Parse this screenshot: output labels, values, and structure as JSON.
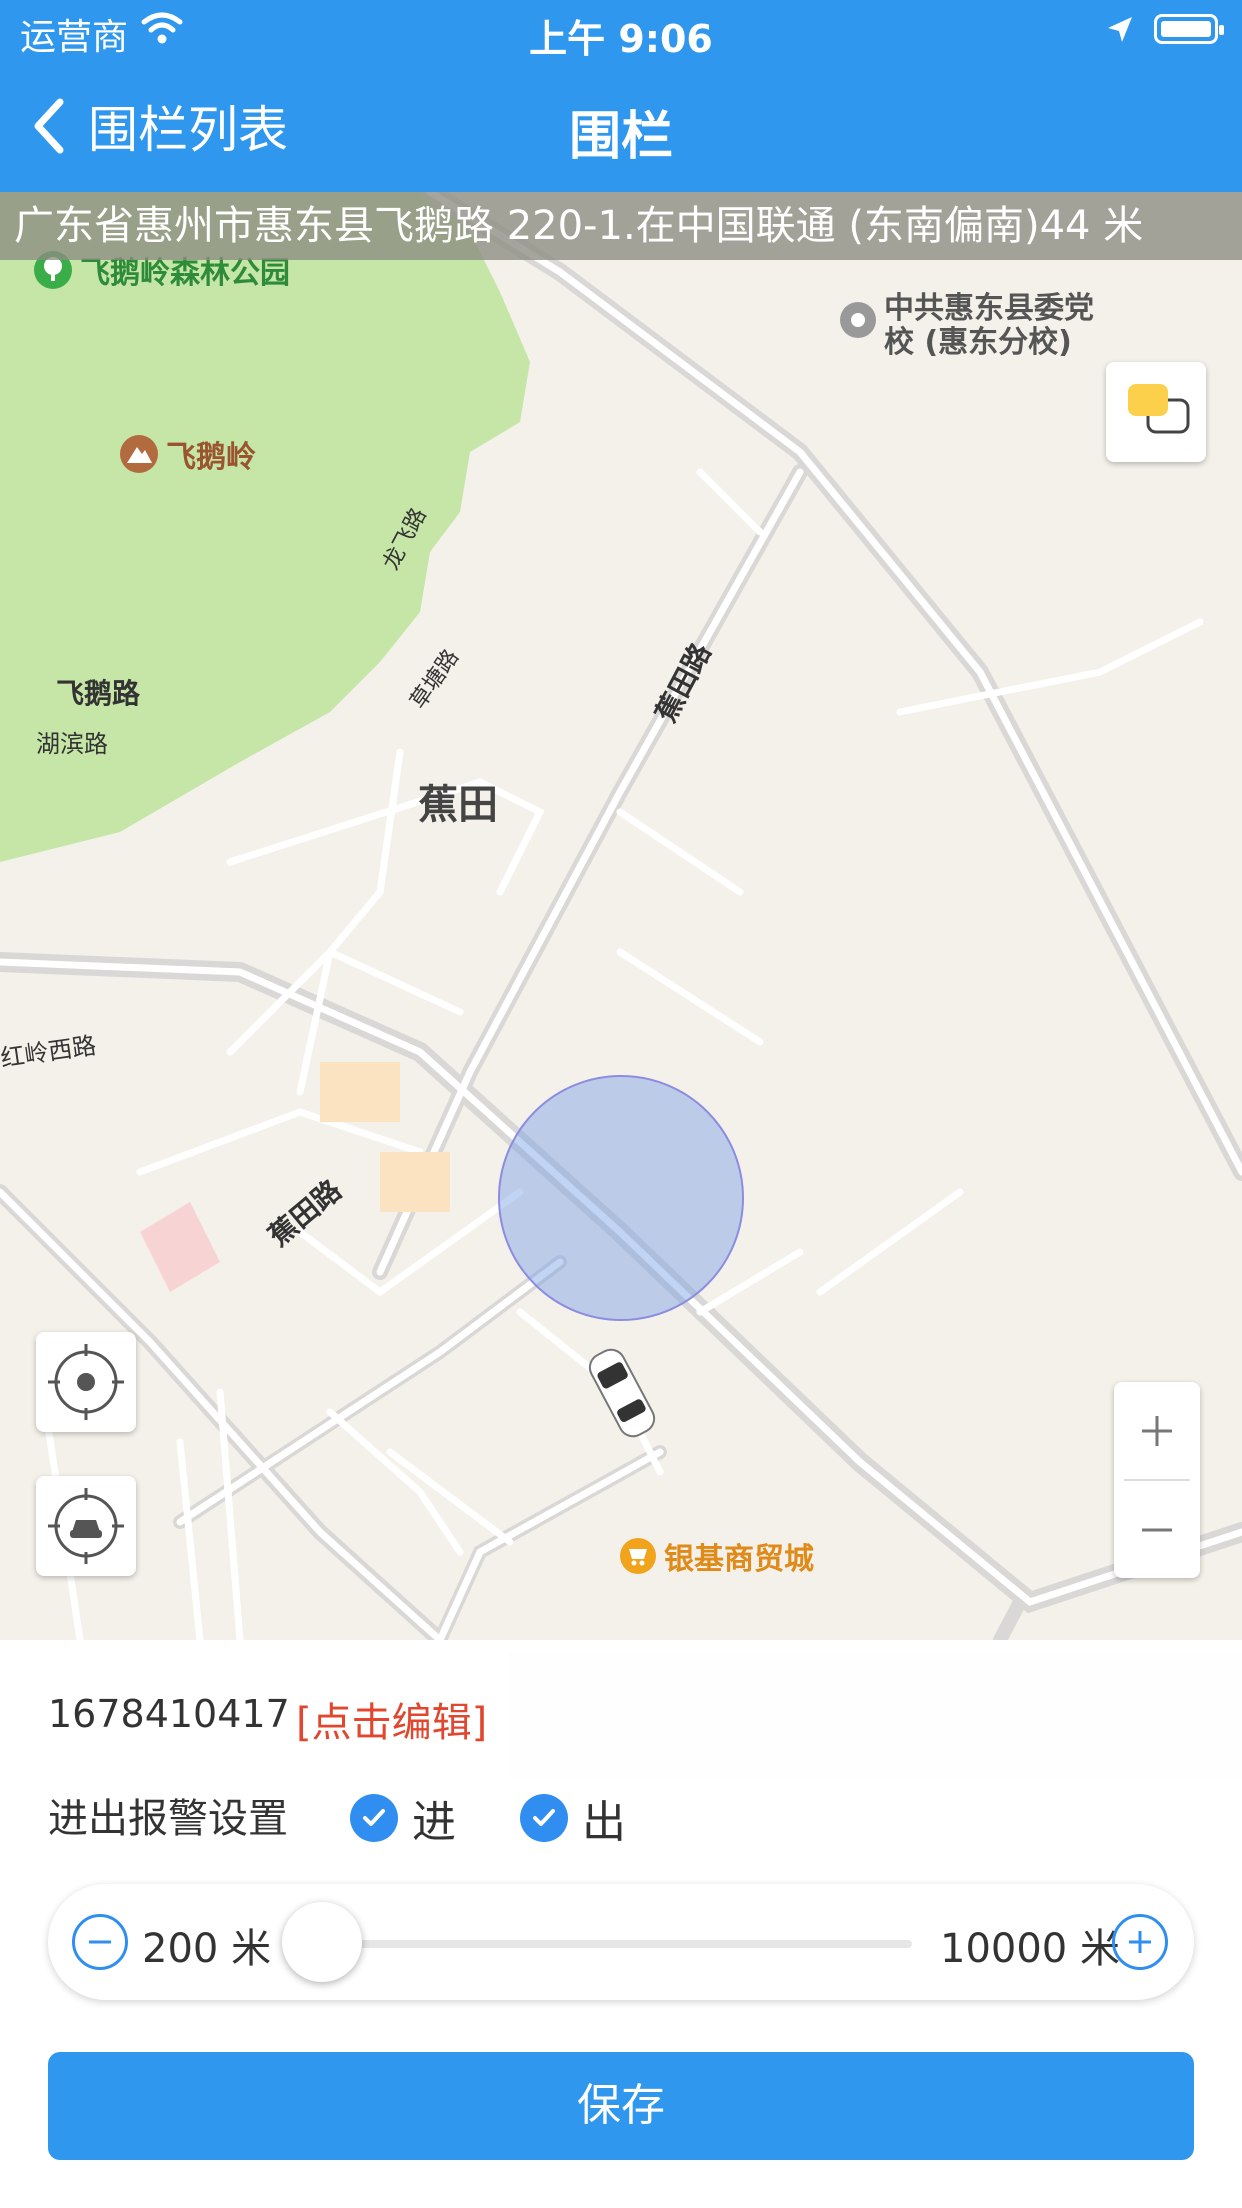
{
  "status_bar": {
    "carrier": "运营商",
    "time": "上午 9:06"
  },
  "nav": {
    "back_label": "围栏列表",
    "title": "围栏"
  },
  "map": {
    "address": "广东省惠州市惠东县飞鹅路 220-1.在中国联通 (东南偏南)44 米",
    "labels": {
      "park": "飞鹅岭森林公园",
      "peak": "飞鹅岭",
      "school_line1": "中共惠东县委党",
      "school_line2": "校 (惠东分校)",
      "jiaotian_road_1": "蕉田路",
      "jiaotian_road_2": "蕉田路",
      "feie_road": "飞鹅路",
      "hubin_road": "湖滨路",
      "longfei_road": "龙飞路",
      "caotang_road": "草塘路",
      "jiaotian": "蕉田",
      "hongling_road": "红岭西路",
      "market": "银基商贸城"
    },
    "colors": {
      "park_green": "#c5e6a6",
      "fence_fill": "#78a0e6",
      "road": "#d9d8d6"
    }
  },
  "panel": {
    "device_id": "1678410417",
    "edit_label": "[点击编辑]",
    "alarm_label": "进出报警设置",
    "enter_label": "进",
    "exit_label": "出",
    "enter_checked": true,
    "exit_checked": true,
    "radius_min": "200 米",
    "radius_max": "10000 米",
    "radius_level": 0,
    "save_label": "保存"
  },
  "colors": {
    "primary": "#2f98ee",
    "edit_red": "#e0472e"
  }
}
